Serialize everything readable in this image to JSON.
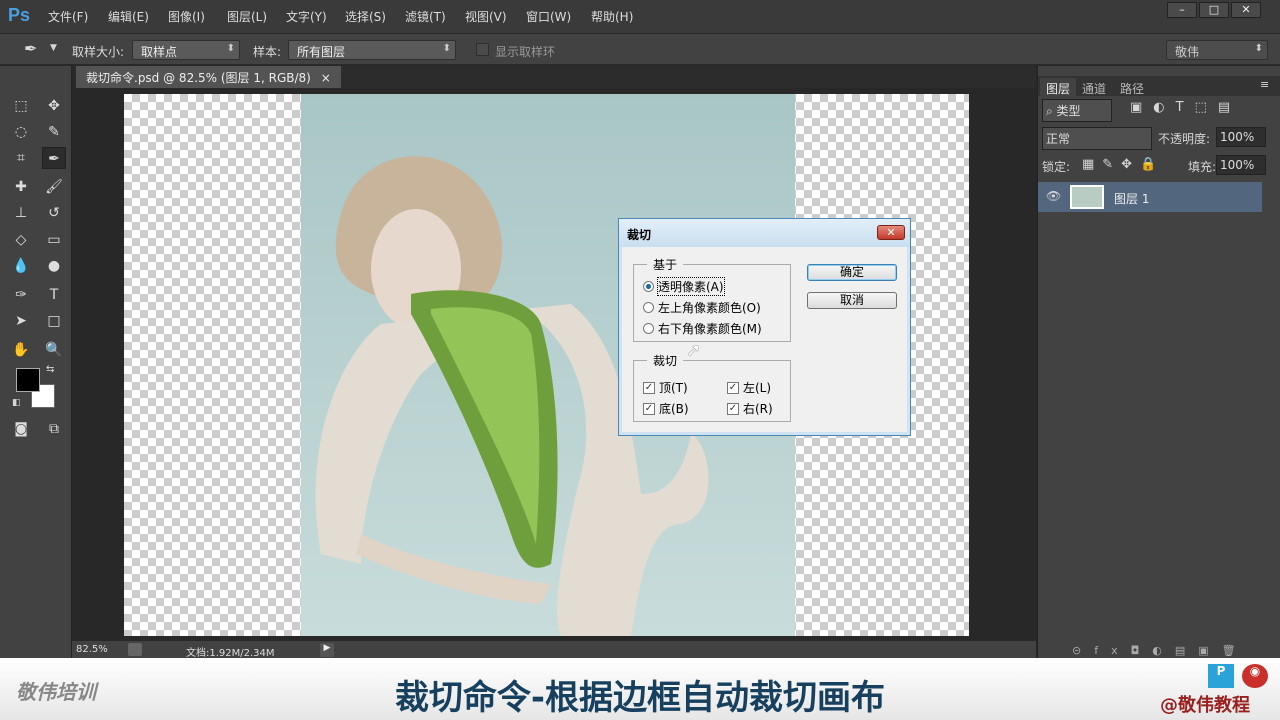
{
  "app": {
    "logo": "Ps"
  },
  "menu": [
    "文件(F)",
    "编辑(E)",
    "图像(I)",
    "图层(L)",
    "文字(Y)",
    "选择(S)",
    "滤镜(T)",
    "视图(V)",
    "窗口(W)",
    "帮助(H)"
  ],
  "window_controls": [
    "–",
    "□",
    "✕"
  ],
  "options": {
    "sample_size_label": "取样大小:",
    "sample_size_value": "取样点",
    "sample_label": "样本:",
    "sample_value": "所有图层",
    "show_ring_label": "显示取样环",
    "workspace": "敬伟"
  },
  "document": {
    "tab_title": "裁切命令.psd @ 82.5% (图层 1, RGB/8)",
    "close": "×"
  },
  "status": {
    "zoom": "82.5%",
    "doc_size": "文档:1.92M/2.34M"
  },
  "layers_panel": {
    "tabs": [
      "图层",
      "通道",
      "路径"
    ],
    "filter_kind": "类型",
    "blend_mode": "正常",
    "opacity_label": "不透明度:",
    "opacity": "100%",
    "lock_label": "锁定:",
    "fill_label": "填充:",
    "fill": "100%",
    "layers": [
      {
        "name": "图层 1",
        "visible": true,
        "selected": true
      }
    ]
  },
  "dialog": {
    "title": "裁切",
    "close": "✕",
    "based_on_label": "基于",
    "based_on": [
      {
        "label": "透明像素(A)",
        "selected": true
      },
      {
        "label": "左上角像素颜色(O)",
        "selected": false
      },
      {
        "label": "右下角像素颜色(M)",
        "selected": false
      }
    ],
    "trim_label": "裁切",
    "trim": [
      {
        "label": "顶(T)",
        "checked": true
      },
      {
        "label": "左(L)",
        "checked": true
      },
      {
        "label": "底(B)",
        "checked": true
      },
      {
        "label": "右(R)",
        "checked": true
      }
    ],
    "ok": "确定",
    "cancel": "取消"
  },
  "banner": {
    "brand": "敬伟培训",
    "title": "裁切命令-根据边框自动裁切画布",
    "handle": "@敬伟教程"
  }
}
